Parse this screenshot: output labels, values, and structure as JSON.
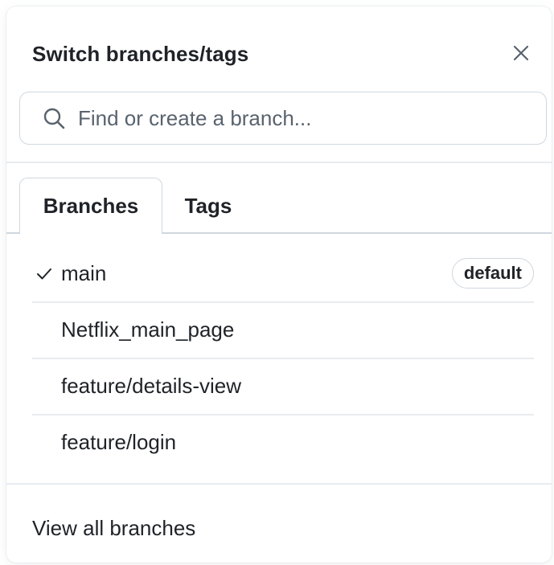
{
  "dialog": {
    "title": "Switch branches/tags",
    "close_label": "×"
  },
  "search": {
    "placeholder": "Find or create a branch..."
  },
  "tabs": [
    {
      "label": "Branches",
      "selected": true
    },
    {
      "label": "Tags",
      "selected": false
    }
  ],
  "branches": [
    {
      "name": "main",
      "checked": true,
      "badge": "default"
    },
    {
      "name": "Netflix_main_page",
      "checked": false
    },
    {
      "name": "feature/details-view",
      "checked": false
    },
    {
      "name": "feature/login",
      "checked": false
    }
  ],
  "footer": {
    "view_all_label": "View all branches"
  },
  "icons": {
    "close": "x-icon",
    "search": "search-icon",
    "selected": "check-icon"
  },
  "colors": {
    "border": "#d0d7de",
    "divider": "#e8ebef",
    "text": "#1f2328",
    "muted": "#59636e"
  }
}
